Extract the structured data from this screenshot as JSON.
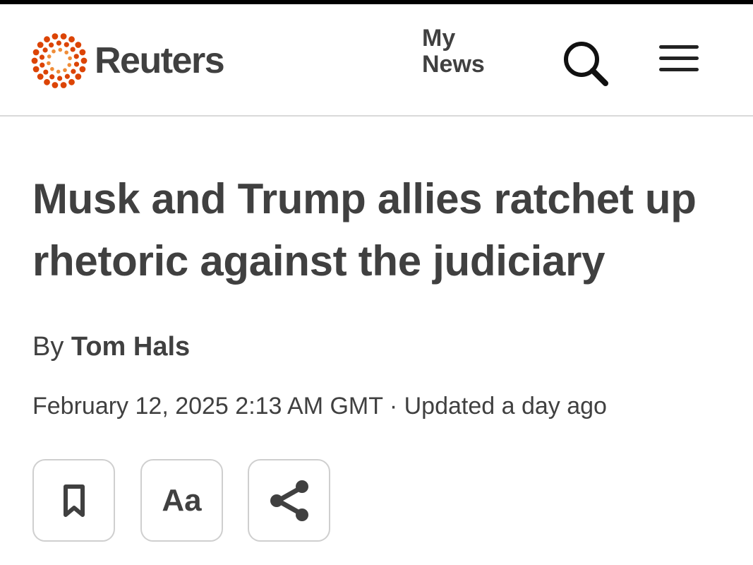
{
  "header": {
    "brand_name": "Reuters",
    "my_news_line1": "My",
    "my_news_line2": "News",
    "search_icon": "search-icon",
    "menu_icon": "hamburger-menu-icon",
    "brand_color": "#dc4405",
    "logo_dot_color": "#ef8d38"
  },
  "article": {
    "headline": "Musk and Trump allies ratchet up rhetoric against the judiciary",
    "byline_prefix": "By",
    "author": "Tom Hals",
    "date": "February 12, 2025 2:13 AM GMT · Updated a day ago"
  },
  "toolbar": {
    "bookmark_icon": "bookmark-icon",
    "text_size_label": "Aa",
    "share_icon": "share-icon"
  }
}
